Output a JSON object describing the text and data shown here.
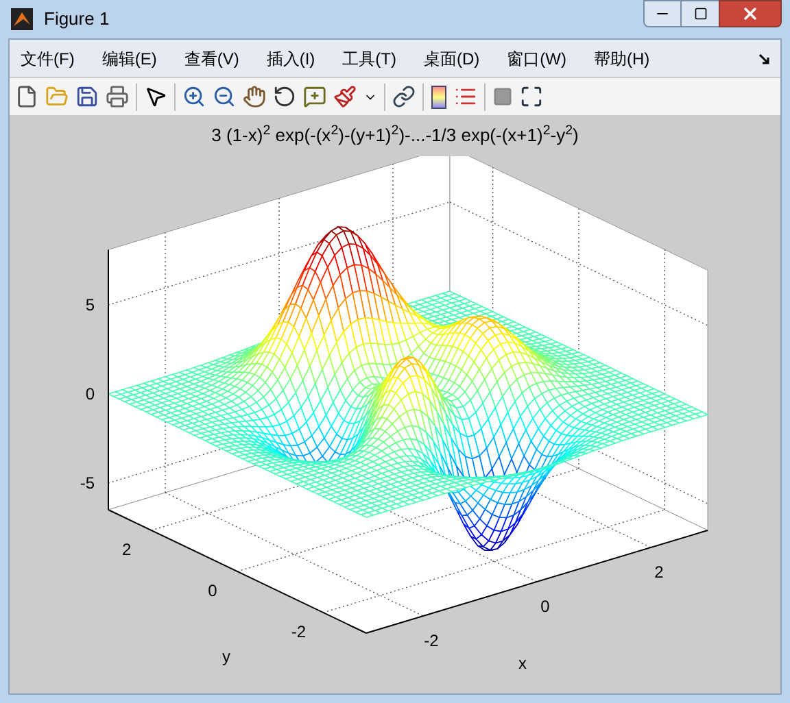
{
  "window": {
    "title": "Figure 1"
  },
  "menu": [
    "文件(F)",
    "编辑(E)",
    "查看(V)",
    "插入(I)",
    "工具(T)",
    "桌面(D)",
    "窗口(W)",
    "帮助(H)"
  ],
  "plot": {
    "title": "3 (1-x)$^{2}$ exp(-(x$^{2}$)-(y+1)$^{2}$)-...-1/3 exp(-(x+1)$^{2}$-y$^{2}$)",
    "z_ticks": [
      "5",
      "0",
      "-5"
    ],
    "y_ticks": [
      "-2",
      "0",
      "2"
    ],
    "x_ticks": [
      "-2",
      "0",
      "2"
    ],
    "xlabel": "x",
    "ylabel": "y"
  }
}
